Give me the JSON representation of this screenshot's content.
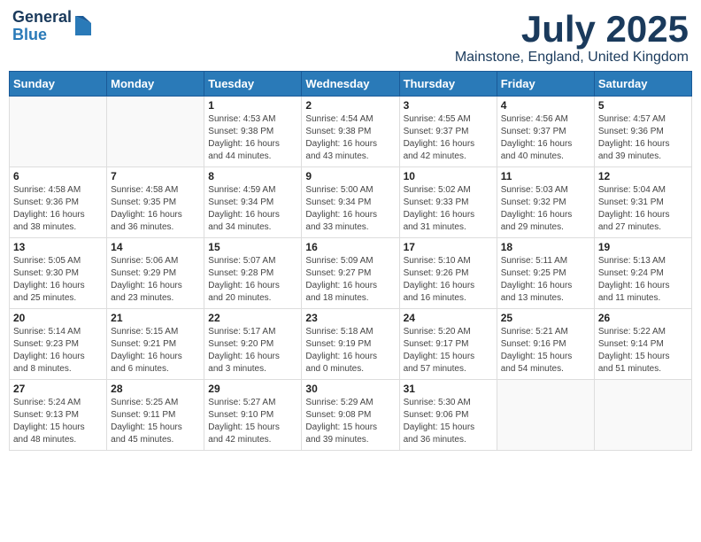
{
  "header": {
    "logo": {
      "general": "General",
      "blue": "Blue"
    },
    "title": "July 2025",
    "location": "Mainstone, England, United Kingdom"
  },
  "calendar": {
    "weekdays": [
      "Sunday",
      "Monday",
      "Tuesday",
      "Wednesday",
      "Thursday",
      "Friday",
      "Saturday"
    ],
    "weeks": [
      [
        {
          "day": "",
          "info": ""
        },
        {
          "day": "",
          "info": ""
        },
        {
          "day": "1",
          "info": "Sunrise: 4:53 AM\nSunset: 9:38 PM\nDaylight: 16 hours\nand 44 minutes."
        },
        {
          "day": "2",
          "info": "Sunrise: 4:54 AM\nSunset: 9:38 PM\nDaylight: 16 hours\nand 43 minutes."
        },
        {
          "day": "3",
          "info": "Sunrise: 4:55 AM\nSunset: 9:37 PM\nDaylight: 16 hours\nand 42 minutes."
        },
        {
          "day": "4",
          "info": "Sunrise: 4:56 AM\nSunset: 9:37 PM\nDaylight: 16 hours\nand 40 minutes."
        },
        {
          "day": "5",
          "info": "Sunrise: 4:57 AM\nSunset: 9:36 PM\nDaylight: 16 hours\nand 39 minutes."
        }
      ],
      [
        {
          "day": "6",
          "info": "Sunrise: 4:58 AM\nSunset: 9:36 PM\nDaylight: 16 hours\nand 38 minutes."
        },
        {
          "day": "7",
          "info": "Sunrise: 4:58 AM\nSunset: 9:35 PM\nDaylight: 16 hours\nand 36 minutes."
        },
        {
          "day": "8",
          "info": "Sunrise: 4:59 AM\nSunset: 9:34 PM\nDaylight: 16 hours\nand 34 minutes."
        },
        {
          "day": "9",
          "info": "Sunrise: 5:00 AM\nSunset: 9:34 PM\nDaylight: 16 hours\nand 33 minutes."
        },
        {
          "day": "10",
          "info": "Sunrise: 5:02 AM\nSunset: 9:33 PM\nDaylight: 16 hours\nand 31 minutes."
        },
        {
          "day": "11",
          "info": "Sunrise: 5:03 AM\nSunset: 9:32 PM\nDaylight: 16 hours\nand 29 minutes."
        },
        {
          "day": "12",
          "info": "Sunrise: 5:04 AM\nSunset: 9:31 PM\nDaylight: 16 hours\nand 27 minutes."
        }
      ],
      [
        {
          "day": "13",
          "info": "Sunrise: 5:05 AM\nSunset: 9:30 PM\nDaylight: 16 hours\nand 25 minutes."
        },
        {
          "day": "14",
          "info": "Sunrise: 5:06 AM\nSunset: 9:29 PM\nDaylight: 16 hours\nand 23 minutes."
        },
        {
          "day": "15",
          "info": "Sunrise: 5:07 AM\nSunset: 9:28 PM\nDaylight: 16 hours\nand 20 minutes."
        },
        {
          "day": "16",
          "info": "Sunrise: 5:09 AM\nSunset: 9:27 PM\nDaylight: 16 hours\nand 18 minutes."
        },
        {
          "day": "17",
          "info": "Sunrise: 5:10 AM\nSunset: 9:26 PM\nDaylight: 16 hours\nand 16 minutes."
        },
        {
          "day": "18",
          "info": "Sunrise: 5:11 AM\nSunset: 9:25 PM\nDaylight: 16 hours\nand 13 minutes."
        },
        {
          "day": "19",
          "info": "Sunrise: 5:13 AM\nSunset: 9:24 PM\nDaylight: 16 hours\nand 11 minutes."
        }
      ],
      [
        {
          "day": "20",
          "info": "Sunrise: 5:14 AM\nSunset: 9:23 PM\nDaylight: 16 hours\nand 8 minutes."
        },
        {
          "day": "21",
          "info": "Sunrise: 5:15 AM\nSunset: 9:21 PM\nDaylight: 16 hours\nand 6 minutes."
        },
        {
          "day": "22",
          "info": "Sunrise: 5:17 AM\nSunset: 9:20 PM\nDaylight: 16 hours\nand 3 minutes."
        },
        {
          "day": "23",
          "info": "Sunrise: 5:18 AM\nSunset: 9:19 PM\nDaylight: 16 hours\nand 0 minutes."
        },
        {
          "day": "24",
          "info": "Sunrise: 5:20 AM\nSunset: 9:17 PM\nDaylight: 15 hours\nand 57 minutes."
        },
        {
          "day": "25",
          "info": "Sunrise: 5:21 AM\nSunset: 9:16 PM\nDaylight: 15 hours\nand 54 minutes."
        },
        {
          "day": "26",
          "info": "Sunrise: 5:22 AM\nSunset: 9:14 PM\nDaylight: 15 hours\nand 51 minutes."
        }
      ],
      [
        {
          "day": "27",
          "info": "Sunrise: 5:24 AM\nSunset: 9:13 PM\nDaylight: 15 hours\nand 48 minutes."
        },
        {
          "day": "28",
          "info": "Sunrise: 5:25 AM\nSunset: 9:11 PM\nDaylight: 15 hours\nand 45 minutes."
        },
        {
          "day": "29",
          "info": "Sunrise: 5:27 AM\nSunset: 9:10 PM\nDaylight: 15 hours\nand 42 minutes."
        },
        {
          "day": "30",
          "info": "Sunrise: 5:29 AM\nSunset: 9:08 PM\nDaylight: 15 hours\nand 39 minutes."
        },
        {
          "day": "31",
          "info": "Sunrise: 5:30 AM\nSunset: 9:06 PM\nDaylight: 15 hours\nand 36 minutes."
        },
        {
          "day": "",
          "info": ""
        },
        {
          "day": "",
          "info": ""
        }
      ]
    ]
  }
}
